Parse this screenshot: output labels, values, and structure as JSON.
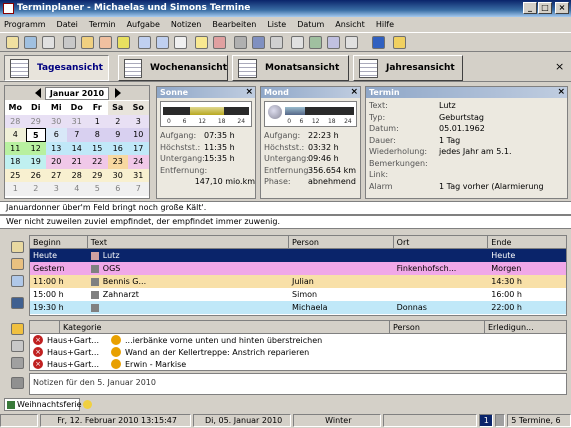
{
  "window": {
    "title": "Terminplaner - Michaelas und Simons  Termine",
    "minimize": "_",
    "maximize": "□",
    "close": "×"
  },
  "menu": [
    "Programm",
    "Datei",
    "Termin",
    "Aufgabe",
    "Notizen",
    "Bearbeiten",
    "Liste",
    "Datum",
    "Ansicht",
    "Hilfe"
  ],
  "toolbar_icons": [
    "new-icon",
    "calendar-icon",
    "print-icon",
    "print-preview-icon",
    "clock-icon",
    "reminder-icon",
    "alarm-icon",
    "copy-icon",
    "paste-icon",
    "cut-icon",
    "note-icon",
    "date-icon",
    "delete-icon",
    "list-icon",
    "week-icon",
    "search-icon",
    "filter-icon",
    "window-icon",
    "window2-icon",
    "help-icon",
    "info-icon"
  ],
  "view_tabs": [
    {
      "label": "Tagesansicht",
      "active": true
    },
    {
      "label": "Wochenansicht",
      "active": false
    },
    {
      "label": "Monatsansicht",
      "active": false
    },
    {
      "label": "Jahresansicht",
      "active": false
    }
  ],
  "calendar": {
    "month_label": "Januar 2010",
    "weekdays": [
      "Mo",
      "Di",
      "Mi",
      "Do",
      "Fr",
      "Sa",
      "So"
    ],
    "weeks": [
      [
        "28",
        "29",
        "30",
        "31",
        "1",
        "2",
        "3"
      ],
      [
        "4",
        "5",
        "6",
        "7",
        "8",
        "9",
        "10"
      ],
      [
        "11",
        "12",
        "13",
        "14",
        "15",
        "16",
        "17"
      ],
      [
        "18",
        "19",
        "20",
        "21",
        "22",
        "23",
        "24"
      ],
      [
        "25",
        "26",
        "27",
        "28",
        "29",
        "30",
        "31"
      ],
      [
        "1",
        "2",
        "3",
        "4",
        "5",
        "6",
        "7"
      ]
    ]
  },
  "sun_panel": {
    "title": "Sonne",
    "scale": [
      "0",
      "6",
      "12",
      "18",
      "24"
    ],
    "rows": [
      {
        "label": "Aufgang:",
        "value": "07:35 h"
      },
      {
        "label": "Höchstst.:",
        "value": "11:35 h"
      },
      {
        "label": "Untergang:",
        "value": "15:35 h"
      },
      {
        "label": "Entfernung:",
        "value": ""
      },
      {
        "label": "",
        "value": "147,10 mio.km"
      }
    ]
  },
  "moon_panel": {
    "title": "Mond",
    "scale": [
      "0",
      "6",
      "12",
      "18",
      "24"
    ],
    "rows": [
      {
        "label": "Aufgang:",
        "value": "22:23 h"
      },
      {
        "label": "Höchstst.:",
        "value": "03:32 h"
      },
      {
        "label": "Untergang:",
        "value": "09:46 h"
      },
      {
        "label": "Entfernung:",
        "value": "356.654 km"
      },
      {
        "label": "Phase:",
        "value": "abnehmend"
      }
    ]
  },
  "termin_panel": {
    "title": "Termin",
    "rows": [
      {
        "label": "Text:",
        "value": "Lutz"
      },
      {
        "label": "Typ:",
        "value": "Geburtstag"
      },
      {
        "label": "Datum:",
        "value": "05.01.1962"
      },
      {
        "label": "Dauer:",
        "value": "1 Tag"
      },
      {
        "label": "Wiederholung:",
        "value": "jedes Jahr am 5.1."
      },
      {
        "label": "Bemerkungen:",
        "value": ""
      },
      {
        "label": "Link:",
        "value": ""
      },
      {
        "label": "Alarm",
        "value": "1 Tag vorher (Alarmierung"
      }
    ]
  },
  "ticker": {
    "line1": "Januardonner über'm Feld bringt noch große Kält'.",
    "line2": "Wer nicht zuweilen zuviel empfindet, der empfindet immer zuwenig."
  },
  "appointments": {
    "columns": [
      "Beginn",
      "Text",
      "Person",
      "Ort",
      "Ende"
    ],
    "rows": [
      {
        "beginn": "Heute",
        "text": "Lutz",
        "person": "",
        "ort": "",
        "ende": "Heute",
        "bg": "#0a246a",
        "fg": "#ffffff"
      },
      {
        "beginn": "Gestern",
        "text": "OGS",
        "person": "",
        "ort": "Finkenhofsch...",
        "ende": "Morgen",
        "bg": "#f0a8e8",
        "fg": "#000000"
      },
      {
        "beginn": "11:00 h",
        "text": "Bennis G...",
        "person": "Julian",
        "ort": "",
        "ende": "14:30 h",
        "bg": "#f8e0a8",
        "fg": "#000000"
      },
      {
        "beginn": "15:00 h",
        "text": "Zahnarzt",
        "person": "Simon",
        "ort": "",
        "ende": "16:00 h",
        "bg": "#ffffff",
        "fg": "#000000"
      },
      {
        "beginn": "19:30 h",
        "text": "",
        "person": "Michaela",
        "ort": "Donnas",
        "ende": "22:00 h",
        "bg": "#c0e8f8",
        "fg": "#000000"
      }
    ]
  },
  "tasks": {
    "columns": [
      "Kategorie",
      "Person",
      "Erledigun..."
    ],
    "rows": [
      {
        "category": "Haus+Gart...",
        "text": "...ierbänke vorne unten und hinten überstreichen"
      },
      {
        "category": "Haus+Gart...",
        "text": "Wand an der Kellertreppe: Anstrich reparieren"
      },
      {
        "category": "Haus+Gart...",
        "text": "Erwin - Markise"
      }
    ]
  },
  "note_placeholder": "Notizen für den 5. Januar 2010",
  "bottom_tab": "Weihnachtsferie",
  "status": {
    "datetime": "Fr, 12. Februar 2010 13:15:47",
    "date": "Di, 05. Januar 2010",
    "season": "Winter",
    "badge": "1",
    "count": "5 Termine, 6"
  },
  "colors": {
    "accent": "#0a246a",
    "title_gradient_end": "#a6caf0",
    "today_border": "#000000"
  }
}
